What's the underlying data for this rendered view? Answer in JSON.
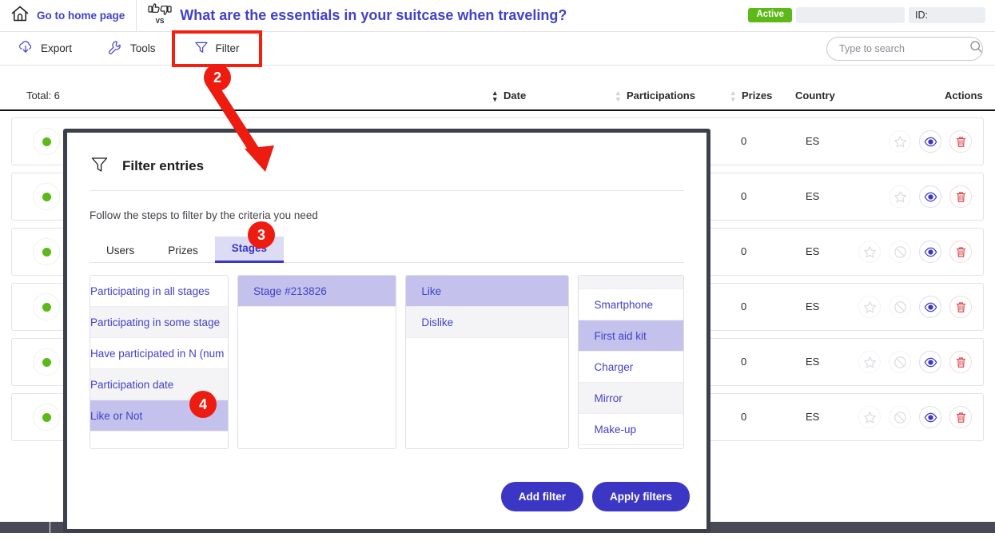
{
  "topbar": {
    "home_label": "Go to home page",
    "home_icon": "home-icon",
    "vs_icon": "thumbs-vs-icon",
    "quiz_title": "What are the essentials in your suitcase when traveling?",
    "status_badge": "Active",
    "id_label": "ID:"
  },
  "toolbar": {
    "export_label": "Export",
    "export_icon": "export-cloud-icon",
    "tools_label": "Tools",
    "tools_icon": "wrench-icon",
    "filter_label": "Filter",
    "filter_icon": "funnel-icon",
    "search_placeholder": "Type to search",
    "search_value": "",
    "search_icon": "search-icon"
  },
  "table": {
    "total_label": "Total: 6",
    "columns": [
      {
        "label": "Date",
        "sortable": true,
        "sort_active": true
      },
      {
        "label": "Participations",
        "sortable": true,
        "sort_active": false
      },
      {
        "label": "Prizes",
        "sortable": true,
        "sort_active": false
      },
      {
        "label": "Country",
        "sortable": false,
        "sort_active": false
      },
      {
        "label": "Actions",
        "sortable": false,
        "sort_active": false
      }
    ],
    "rows": [
      {
        "status": "active",
        "prizes": "0",
        "country": "ES",
        "actions": [
          "star-icon",
          "eye-icon",
          "trash-icon"
        ]
      },
      {
        "status": "active",
        "prizes": "0",
        "country": "ES",
        "actions": [
          "star-icon",
          "eye-icon",
          "trash-icon"
        ]
      },
      {
        "status": "active",
        "prizes": "0",
        "country": "ES",
        "actions": [
          "star-icon",
          "ban-icon",
          "eye-icon",
          "trash-icon"
        ]
      },
      {
        "status": "active",
        "prizes": "0",
        "country": "ES",
        "actions": [
          "star-icon",
          "ban-icon",
          "eye-icon",
          "trash-icon"
        ]
      },
      {
        "status": "active",
        "prizes": "0",
        "country": "ES",
        "actions": [
          "star-icon",
          "ban-icon",
          "eye-icon",
          "trash-icon"
        ]
      },
      {
        "status": "active",
        "prizes": "0",
        "country": "ES",
        "actions": [
          "star-icon",
          "ban-icon",
          "eye-icon",
          "trash-icon"
        ]
      }
    ]
  },
  "modal": {
    "title": "Filter entries",
    "title_icon": "funnel-icon",
    "subtitle": "Follow the steps to filter by the criteria you need",
    "tabs": [
      {
        "label": "Users",
        "active": false
      },
      {
        "label": "Prizes",
        "active": false
      },
      {
        "label": "Stages",
        "active": true
      }
    ],
    "criteria_column": [
      {
        "label": "Participating in all stages",
        "selected": false
      },
      {
        "label": "Participating in some stage",
        "selected": false
      },
      {
        "label": "Have participated in N (num",
        "selected": false
      },
      {
        "label": "Participation date",
        "selected": false
      },
      {
        "label": "Like or Not",
        "selected": true
      }
    ],
    "stage_column": [
      {
        "label": "Stage #213826",
        "selected": true
      }
    ],
    "choice_column": [
      {
        "label": "Like",
        "selected": true
      },
      {
        "label": "Dislike",
        "selected": false
      }
    ],
    "item_column": [
      {
        "label": "Smartphone",
        "selected": false
      },
      {
        "label": "First aid kit",
        "selected": true
      },
      {
        "label": "Charger",
        "selected": false
      },
      {
        "label": "Mirror",
        "selected": false
      },
      {
        "label": "Make-up",
        "selected": false
      }
    ],
    "add_filter_label": "Add filter",
    "apply_filters_label": "Apply filters"
  },
  "annotations": {
    "steps": [
      {
        "number": "2",
        "target": "filter-toolbar-button"
      },
      {
        "number": "3",
        "target": "tab-stages"
      },
      {
        "number": "4",
        "target": "criteria-like-or-not"
      }
    ],
    "arrow": "red-arrow-filter-to-modal"
  },
  "colors": {
    "brand": "#3b37c4",
    "link": "#4340c9",
    "accent_red": "#ee1b10",
    "status_green": "#5cb917",
    "selected_row": "#c4c2ec"
  }
}
